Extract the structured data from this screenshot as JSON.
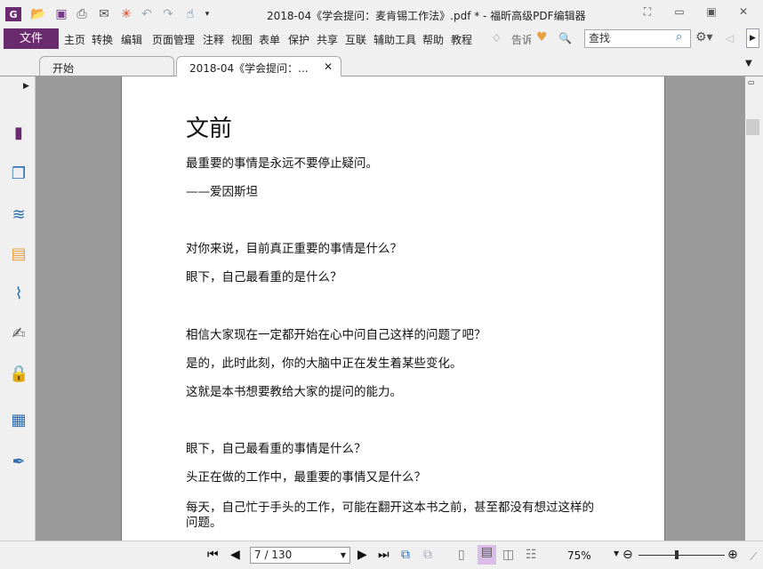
{
  "title": "2018-04《学会提问：麦肯锡工作法》.pdf * - 福昕高级PDF编辑器",
  "menu": {
    "file": "文件",
    "items": [
      "主页",
      "转换",
      "编辑",
      "页面管理",
      "注释",
      "视图",
      "表单",
      "保护",
      "共享",
      "互联",
      "辅助工具",
      "帮助",
      "教程"
    ],
    "tell": "告诉",
    "search_placeholder": "查找"
  },
  "tabs": [
    "开始",
    "2018-04《学会提问：..."
  ],
  "page": {
    "heading": "文前",
    "lines": [
      "最重要的事情是永远不要停止疑问。",
      "——爱因斯坦",
      "对你来说，目前真正重要的事情是什么？",
      "眼下，自己最看重的是什么？",
      "相信大家现在一定都开始在心中问自己这样的问题了吧？",
      "是的，此时此刻，你的大脑中正在发生着某些变化。",
      "这就是本书想要教给大家的提问的能力。",
      "眼下，自己最看重的事情是什么？",
      "头正在做的工作中，最重要的事情又是什么？",
      "每天，自己忙于手头的工作，可能在翻开这本书之前，甚至都没有想过这样的问题。"
    ]
  },
  "status": {
    "page": "7 / 130",
    "zoom": "75%",
    "zoom_fraction": 0.5
  },
  "colors": {
    "accent": "#6a2b6e"
  }
}
